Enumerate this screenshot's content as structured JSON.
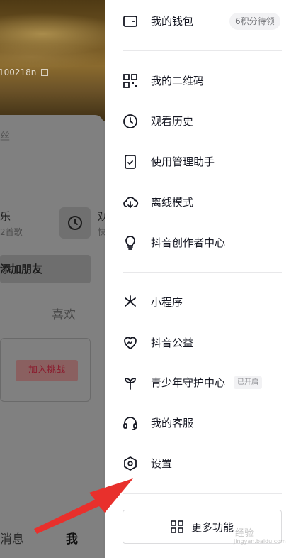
{
  "background": {
    "user_id": "100218n",
    "fans_label": "丝",
    "music_title": "乐",
    "music_count": "2首歌",
    "watch_title": "观",
    "watch_sub": "快",
    "add_friend": "添加朋友",
    "likes_tab": "喜欢",
    "challenge_button": "加入挑战",
    "tab_messages": "消息",
    "tab_me": "我"
  },
  "menu": {
    "items": [
      {
        "label": "我的钱包",
        "icon": "wallet-icon",
        "badge": "6积分待领"
      },
      {
        "label": "我的二维码",
        "icon": "qr-code-icon"
      },
      {
        "label": "观看历史",
        "icon": "clock-icon"
      },
      {
        "label": "使用管理助手",
        "icon": "phone-check-icon"
      },
      {
        "label": "离线模式",
        "icon": "cloud-download-icon"
      },
      {
        "label": "抖音创作者中心",
        "icon": "lightbulb-icon"
      },
      {
        "label": "小程序",
        "icon": "mini-program-icon"
      },
      {
        "label": "抖音公益",
        "icon": "heart-charity-icon"
      },
      {
        "label": "青少年守护中心",
        "icon": "sprout-icon",
        "badge": "已开启"
      },
      {
        "label": "我的客服",
        "icon": "headset-icon"
      },
      {
        "label": "设置",
        "icon": "settings-hexagon-icon"
      }
    ],
    "more_button": {
      "label": "更多功能",
      "icon": "grid-apps-icon"
    }
  },
  "annotation": {
    "icon": "red-arrow-icon",
    "color": "#e8302c"
  },
  "watermark": {
    "text": "经验",
    "sub": "jingyan.baidu.com"
  },
  "colors": {
    "text": "#161823",
    "divider": "#e8e8ea",
    "badge_bg": "#f2f2f4",
    "overlay": "#808080"
  }
}
